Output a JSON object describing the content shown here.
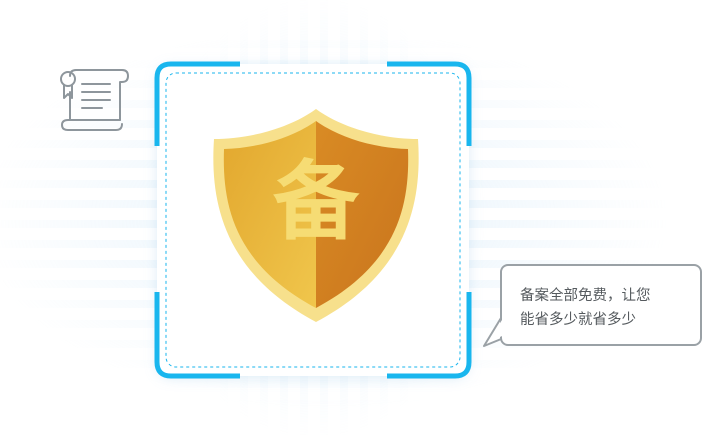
{
  "badge": {
    "glyph": "备",
    "icon": "filing-shield-icon",
    "colors": {
      "shield_light": "#e7b83a",
      "shield_dark": "#cf7e20",
      "shield_rim": "#f7e08c",
      "glyph": "#f6dc74"
    }
  },
  "certificate": {
    "icon": "certificate-scroll-icon",
    "stamp_text": "Ⓑ"
  },
  "frame": {
    "accent_color": "#19b6ee"
  },
  "callout": {
    "line1": "备案全部免费，让您",
    "line2": "能省多少就省多少",
    "border_color": "#9aa1a6"
  }
}
